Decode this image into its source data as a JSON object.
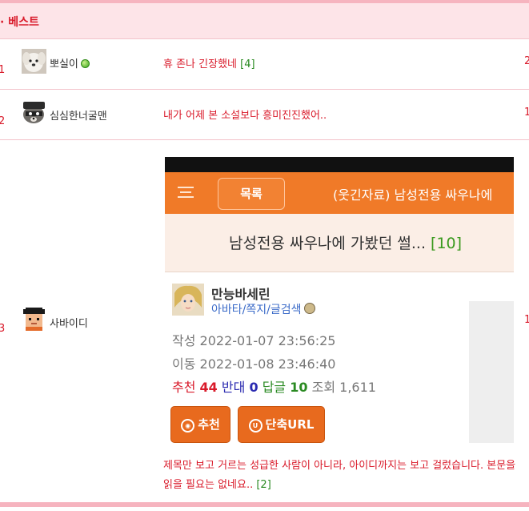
{
  "section": {
    "title": "· 베스트"
  },
  "rows": [
    {
      "rank": "1",
      "nickname": "뽀실이",
      "title": "휴 존나 긴장했네",
      "comment_count": "[4]",
      "right_count": "2"
    },
    {
      "rank": "2",
      "nickname": "심심한너굴맨",
      "title": "내가 어제 본 소설보다 흥미진진했어..",
      "right_count": "1"
    },
    {
      "rank": "3",
      "nickname": "사바이디",
      "right_count": "1"
    }
  ],
  "embedded": {
    "list_button": "목록",
    "bar_title": "(웃긴자료) 남성전용 싸우나에",
    "post_title": "남성전용 싸우나에 가봤던 썰...",
    "post_comment_count": "[10]",
    "author": "만능바세린",
    "author_links": "아바타/쪽지/글검색",
    "written_label": "작성",
    "written": "2022-01-07 23:56:25",
    "moved_label": "이동",
    "moved": "2022-01-08 23:46:40",
    "recommend_label": "추천",
    "recommend": "44",
    "oppose_label": "반대",
    "oppose": "0",
    "reply_label": "답글",
    "reply": "10",
    "views_label": "조회",
    "views": "1,611",
    "recommend_button": "추천",
    "short_url_button": "단축URL"
  },
  "comment": {
    "text": "제목만 보고 거르는 성급한 사람이 아니라, 아이디까지는 보고 걸렀습니다. 본문을 읽을 필요는 없네요..",
    "count": "[2]"
  },
  "colors": {
    "accent": "#d91a2a",
    "header_bg": "#fde4e8",
    "orange": "#f07a28",
    "comment_green": "#2a8a22"
  }
}
